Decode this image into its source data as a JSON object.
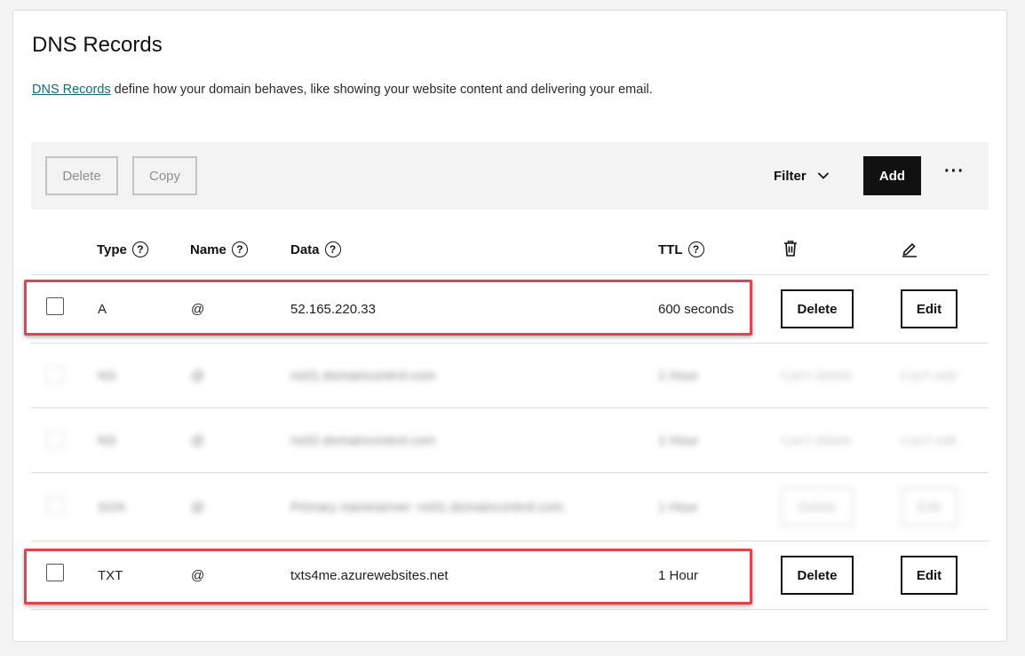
{
  "page": {
    "title": "DNS Records",
    "description_link": "DNS Records",
    "description_rest": " define how your domain behaves, like showing your website content and delivering your email."
  },
  "toolbar": {
    "delete_label": "Delete",
    "copy_label": "Copy",
    "filter_label": "Filter",
    "add_label": "Add",
    "more_label": "···"
  },
  "columns": {
    "type": "Type",
    "name": "Name",
    "data": "Data",
    "ttl": "TTL",
    "help_glyph": "?"
  },
  "rows": [
    {
      "type": "A",
      "name": "@",
      "data": "52.165.220.33",
      "ttl": "600 seconds",
      "delete": "Delete",
      "edit": "Edit"
    },
    {
      "type": "NS",
      "name": "@",
      "data": "ns01.domaincontrol.com",
      "ttl": "1 Hour",
      "delete": "Can't delete",
      "edit": "Can't edit"
    },
    {
      "type": "NS",
      "name": "@",
      "data": "ns02.domaincontrol.com",
      "ttl": "1 Hour",
      "delete": "Can't delete",
      "edit": "Can't edit"
    },
    {
      "type": "SOA",
      "name": "@",
      "data": "Primary nameserver: ns01.domaincontrol.com.",
      "ttl": "1 Hour",
      "delete": "Delete",
      "edit": "Edit"
    },
    {
      "type": "TXT",
      "name": "@",
      "data": "txts4me.azurewebsites.net",
      "ttl": "1 Hour",
      "delete": "Delete",
      "edit": "Edit"
    }
  ],
  "colors": {
    "link": "#0d6e78",
    "highlight": "#e0454f",
    "primary_button": "#111111"
  }
}
